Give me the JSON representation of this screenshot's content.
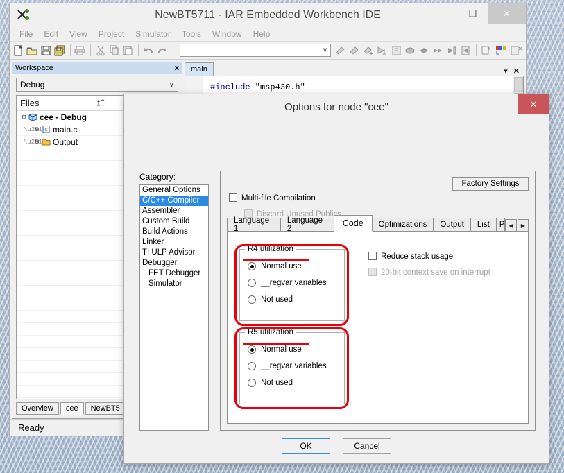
{
  "window": {
    "title": "NewBT5711 - IAR Embedded Workbench IDE",
    "app_icon": "scissors-tools-icon",
    "minimize": "–",
    "maximize": "❑",
    "close": "✕"
  },
  "menubar": {
    "items": [
      "File",
      "Edit",
      "View",
      "Project",
      "Simulator",
      "Tools",
      "Window",
      "Help"
    ]
  },
  "toolbar": {
    "combo_value": "",
    "combo_arrow": "∨",
    "icons": [
      "new-file-icon",
      "open-folder-icon",
      "save-icon",
      "save-all-icon",
      "print-icon",
      "cut-icon",
      "copy-icon",
      "paste-icon",
      "undo-icon",
      "redo-icon",
      "compile-icon",
      "make-icon",
      "make-debug-icon",
      "stop-build-icon",
      "debug-log-icon",
      "next-statement-icon",
      "step-over-icon",
      "step-into-icon",
      "step-out-icon",
      "next-icon",
      "go-icon",
      "breakpoint-icon",
      "registers-icon",
      "disassembly-icon"
    ]
  },
  "workspace": {
    "title": "Workspace",
    "close": "x",
    "config": "Debug",
    "config_arrow": "∨",
    "files_header": "Files",
    "header_icons": [
      "sort-icon",
      "open-files-icon"
    ],
    "tree": [
      {
        "expander": "⊟",
        "icon": "project-cube-icon",
        "label": "cee - Debug",
        "bold": true,
        "indent": 0
      },
      {
        "expander": "⊞",
        "icon": "c-file-icon",
        "label": "main.c",
        "bold": false,
        "indent": 1
      },
      {
        "expander": "⊞",
        "icon": "folder-icon",
        "label": "Output",
        "bold": false,
        "indent": 1
      }
    ],
    "tabs": [
      {
        "label": "Overview",
        "active": false
      },
      {
        "label": "cee",
        "active": true
      },
      {
        "label": "NewBT5",
        "active": false
      }
    ]
  },
  "editor": {
    "tab": "main",
    "menu_arrow": "▾",
    "close": "✕",
    "code_keyword": "#include",
    "code_rest": " \"msp430.h\"",
    "scroll_up": "∧"
  },
  "statusbar": {
    "text": "Ready"
  },
  "dialog": {
    "title": "Options for node \"cee\"",
    "close": "✕",
    "category_label": "Category:",
    "categories": [
      {
        "label": "General Options",
        "selected": false,
        "indent": false
      },
      {
        "label": "C/C++ Compiler",
        "selected": true,
        "indent": false
      },
      {
        "label": "Assembler",
        "selected": false,
        "indent": false
      },
      {
        "label": "Custom Build",
        "selected": false,
        "indent": false
      },
      {
        "label": "Build Actions",
        "selected": false,
        "indent": false
      },
      {
        "label": "Linker",
        "selected": false,
        "indent": false
      },
      {
        "label": "TI ULP Advisor",
        "selected": false,
        "indent": false
      },
      {
        "label": "Debugger",
        "selected": false,
        "indent": false
      },
      {
        "label": "FET Debugger",
        "selected": false,
        "indent": true
      },
      {
        "label": "Simulator",
        "selected": false,
        "indent": true
      }
    ],
    "factory_settings": "Factory Settings",
    "multifile": {
      "label": "Multi-file Compilation",
      "checked": false,
      "enabled": true
    },
    "discard": {
      "label": "Discard Unused Publics",
      "checked": false,
      "enabled": false
    },
    "tabs": [
      {
        "label": "Language 1",
        "selected": false,
        "clipped": false
      },
      {
        "label": "Language 2",
        "selected": false,
        "clipped": false
      },
      {
        "label": "Code",
        "selected": true,
        "clipped": false
      },
      {
        "label": "Optimizations",
        "selected": false,
        "clipped": false
      },
      {
        "label": "Output",
        "selected": false,
        "clipped": false
      },
      {
        "label": "List",
        "selected": false,
        "clipped": false
      },
      {
        "label": "P",
        "selected": false,
        "clipped": true
      }
    ],
    "tab_scroll_left": "◀",
    "tab_scroll_right": "▶",
    "groups": [
      {
        "legend": "R4 utilization",
        "annotated": true,
        "options": [
          {
            "label": "Normal use",
            "selected": true
          },
          {
            "label": "__regvar variables",
            "selected": false
          },
          {
            "label": "Not used",
            "selected": false
          }
        ]
      },
      {
        "legend": "R5 utilization",
        "annotated": true,
        "options": [
          {
            "label": "Normal use",
            "selected": true
          },
          {
            "label": "__regvar variables",
            "selected": false
          },
          {
            "label": "Not used",
            "selected": false
          }
        ]
      }
    ],
    "right_checks": [
      {
        "label": "Reduce stack usage",
        "checked": false,
        "enabled": true
      },
      {
        "label": "20-bit context save on interrupt",
        "checked": false,
        "enabled": false
      }
    ],
    "ok": "OK",
    "cancel": "Cancel"
  },
  "annotation_color": "#e8000b"
}
